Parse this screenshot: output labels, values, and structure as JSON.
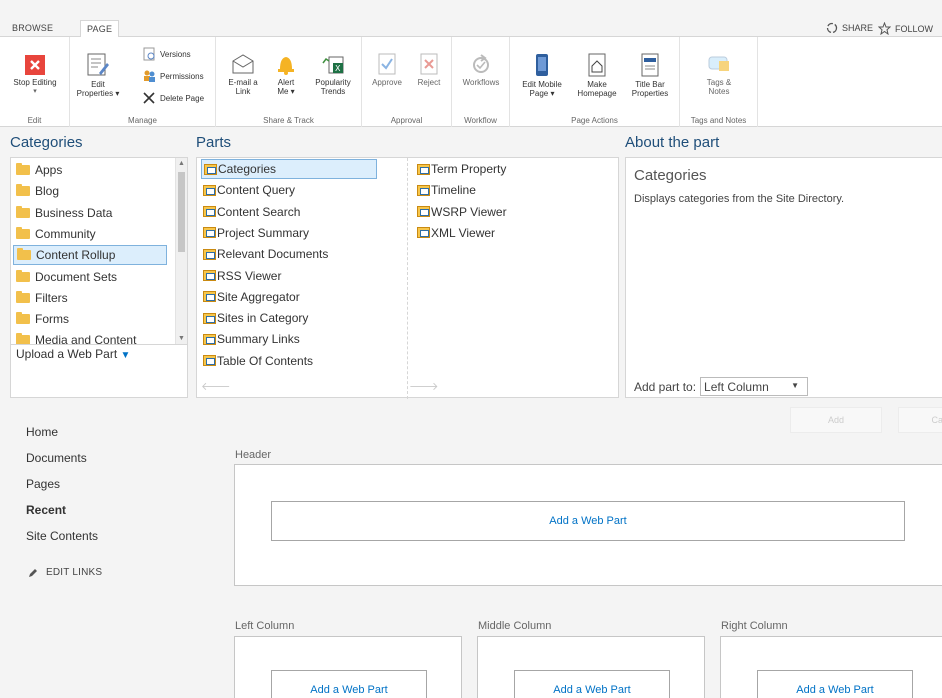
{
  "ribbon_tabs": {
    "browse": "BROWSE",
    "page": "PAGE"
  },
  "top_actions": {
    "share": "SHARE",
    "follow": "FOLLOW"
  },
  "ribbon": {
    "edit_group": {
      "label": "Edit",
      "stop_editing": "Stop Editing"
    },
    "manage_group": {
      "label": "Manage",
      "edit_properties_1": "Edit",
      "edit_properties_2": "Properties",
      "versions": "Versions",
      "permissions": "Permissions",
      "delete_page": "Delete Page"
    },
    "share_group": {
      "label": "Share & Track",
      "email_1": "E-mail a",
      "email_2": "Link",
      "alert_1": "Alert",
      "alert_2": "Me",
      "popularity_1": "Popularity",
      "popularity_2": "Trends"
    },
    "approval_group": {
      "label": "Approval",
      "approve": "Approve",
      "reject": "Reject"
    },
    "workflow_group": {
      "label": "Workflow",
      "workflows": "Workflows"
    },
    "page_actions_group": {
      "label": "Page Actions",
      "edit_mobile_1": "Edit Mobile",
      "edit_mobile_2": "Page",
      "make_homepage_1": "Make",
      "make_homepage_2": "Homepage",
      "title_bar_1": "Title Bar",
      "title_bar_2": "Properties"
    },
    "tags_group": {
      "label": "Tags and Notes",
      "tags_1": "Tags &",
      "tags_2": "Notes"
    }
  },
  "picker": {
    "categories_title": "Categories",
    "parts_title": "Parts",
    "about_title": "About the part",
    "categories": [
      "Apps",
      "Blog",
      "Business Data",
      "Community",
      "Content Rollup",
      "Document Sets",
      "Filters",
      "Forms",
      "Media and Content"
    ],
    "selected_category": "Content Rollup",
    "parts_col1": [
      "Categories",
      "Content Query",
      "Content Search",
      "Project Summary",
      "Relevant Documents",
      "RSS Viewer",
      "Site Aggregator",
      "Sites in Category",
      "Summary Links",
      "Table Of Contents"
    ],
    "parts_col2": [
      "Term Property",
      "Timeline",
      "WSRP Viewer",
      "XML Viewer"
    ],
    "selected_part": "Categories",
    "upload_label": "Upload a Web Part",
    "about_name": "Categories",
    "about_description": "Displays categories from the Site Directory.",
    "add_part_to_label": "Add part to:",
    "add_part_to_value": "Left Column",
    "add_button": "Add",
    "cancel_button": "Ca"
  },
  "nav": {
    "items": [
      "Home",
      "Documents",
      "Pages",
      "Recent",
      "Site Contents"
    ],
    "current": "Recent",
    "edit_links": "EDIT LINKS"
  },
  "zones": {
    "header_label": "Header",
    "left_label": "Left Column",
    "middle_label": "Middle Column",
    "right_label": "Right Column",
    "add_web_part": "Add a Web Part"
  },
  "colors": {
    "accent": "#0072c6",
    "title_blue": "#1f4e79",
    "selection": "#dceefc",
    "stop_red": "#e8453c"
  }
}
